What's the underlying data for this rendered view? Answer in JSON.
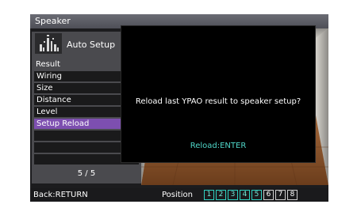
{
  "header": {
    "title": "Speaker"
  },
  "left_panel": {
    "icon": "speaker-icon",
    "mode_label": "Auto Setup",
    "section_label": "Result",
    "menu_items": [
      {
        "label": "Wiring",
        "selected": false
      },
      {
        "label": "Size",
        "selected": false
      },
      {
        "label": "Distance",
        "selected": false
      },
      {
        "label": "Level",
        "selected": false
      },
      {
        "label": "Setup Reload",
        "selected": true
      },
      {
        "label": "",
        "selected": false
      },
      {
        "label": "",
        "selected": false
      },
      {
        "label": "",
        "selected": false
      }
    ],
    "pager": "5 / 5"
  },
  "dialog": {
    "message": "Reload last YPAO result to speaker setup?",
    "action_hint": "Reload:ENTER"
  },
  "footer": {
    "back_hint": "Back:RETURN",
    "position_label": "Position",
    "positions": [
      {
        "label": "1",
        "active": true
      },
      {
        "label": "2",
        "active": true
      },
      {
        "label": "3",
        "active": true
      },
      {
        "label": "4",
        "active": true
      },
      {
        "label": "5",
        "active": true
      },
      {
        "label": "6",
        "active": false
      },
      {
        "label": "7",
        "active": false
      },
      {
        "label": "8",
        "active": false
      }
    ]
  },
  "colors": {
    "selected_item": "#7d4fb0",
    "action_text": "#4fd6c8",
    "active_position": "#2fd0c0"
  }
}
